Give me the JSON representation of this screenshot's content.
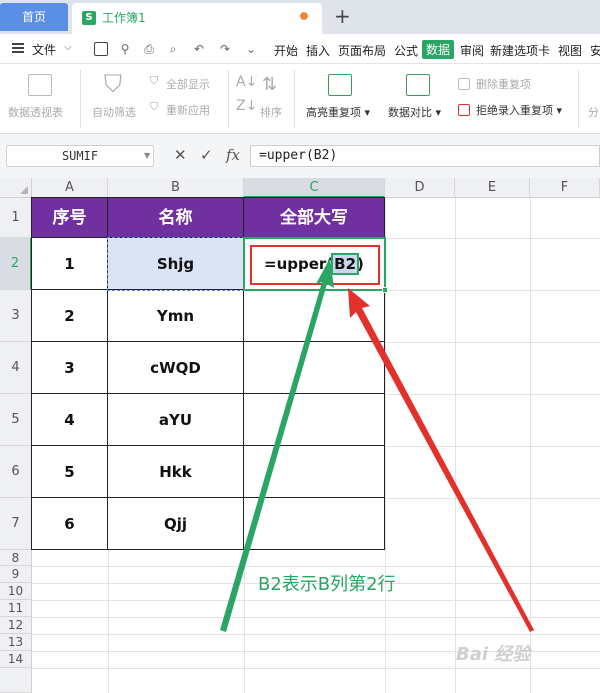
{
  "tabs": {
    "home": "首页",
    "workbook": "工作簿1",
    "add": "+"
  },
  "menu": {
    "file": "文件",
    "items": [
      "开始",
      "插入",
      "页面布局",
      "公式",
      "数据",
      "审阅",
      "新建选项卡",
      "视图",
      "安"
    ],
    "active": "数据"
  },
  "ribbon": {
    "pivot": "数据透视表",
    "autofilter": "自动筛选",
    "show_all": "全部显示",
    "reapply": "重新应用",
    "sort": "排序",
    "highlight_dup": "高亮重复项",
    "data_compare": "数据对比",
    "remove_dup": "删除重复项",
    "reject_dup": "拒绝录入重复项",
    "split": "分"
  },
  "formula_bar": {
    "name_box": "SUMIF",
    "cancel": "✕",
    "confirm": "✓",
    "fx": "fx",
    "formula": "=upper(B2)"
  },
  "columns": [
    "A",
    "B",
    "C",
    "D",
    "E",
    "F"
  ],
  "rows": [
    "1",
    "2",
    "3",
    "4",
    "5",
    "6",
    "7",
    "8",
    "9",
    "10",
    "11",
    "12",
    "13",
    "14"
  ],
  "table": {
    "headers": [
      "序号",
      "名称",
      "全部大写"
    ],
    "rows": [
      [
        "1",
        "Shjg"
      ],
      [
        "2",
        "Ymn"
      ],
      [
        "3",
        "cWQD"
      ],
      [
        "4",
        "aYU"
      ],
      [
        "5",
        "Hkk"
      ],
      [
        "6",
        "Qjj"
      ]
    ]
  },
  "cell_c2": {
    "prefix": "=upper(",
    "ref": "B2",
    "suffix": ")"
  },
  "annotation": "B2表示B列第2行",
  "watermark": "Bai 经验",
  "colors": {
    "header_bg": "#7030a0",
    "accent_green": "#2aa564",
    "arrow_red": "#e3302a",
    "selection_blue": "#dbe4f4"
  }
}
